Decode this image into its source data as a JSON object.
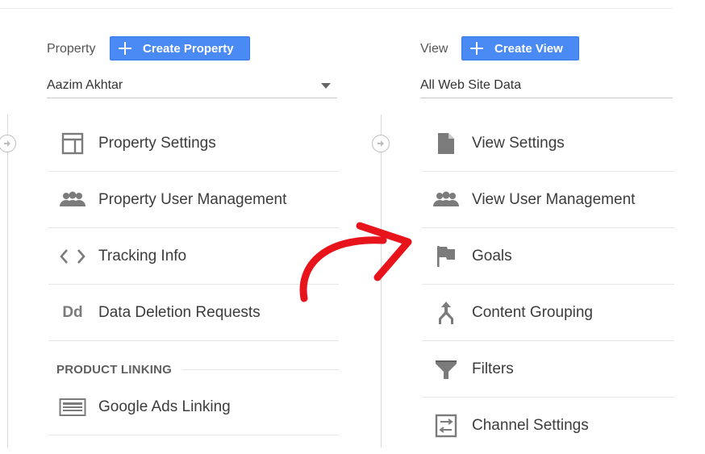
{
  "property": {
    "label": "Property",
    "create_button": "Create Property",
    "selected": "Aazim Akhtar",
    "menu": [
      {
        "label": "Property Settings",
        "icon": "layout-icon"
      },
      {
        "label": "Property User Management",
        "icon": "people-icon"
      },
      {
        "label": "Tracking Info",
        "icon": "code-icon"
      },
      {
        "label": "Data Deletion Requests",
        "icon": "dd-icon"
      }
    ],
    "product_linking": {
      "heading": "PRODUCT LINKING",
      "items": [
        {
          "label": "Google Ads Linking",
          "icon": "ads-linking-icon"
        }
      ]
    },
    "dd_glyph": "Dd"
  },
  "view": {
    "label": "View",
    "create_button": "Create View",
    "selected": "All Web Site Data",
    "menu": [
      {
        "label": "View Settings",
        "icon": "document-icon"
      },
      {
        "label": "View User Management",
        "icon": "people-icon"
      },
      {
        "label": "Goals",
        "icon": "flag-icon"
      },
      {
        "label": "Content Grouping",
        "icon": "grouping-icon"
      },
      {
        "label": "Filters",
        "icon": "filter-icon"
      },
      {
        "label": "Channel Settings",
        "icon": "channel-settings-icon"
      }
    ]
  },
  "colors": {
    "button_blue": "#4a8af4",
    "icon_gray": "#7b7b7b",
    "annotation_red": "#e8141c"
  }
}
